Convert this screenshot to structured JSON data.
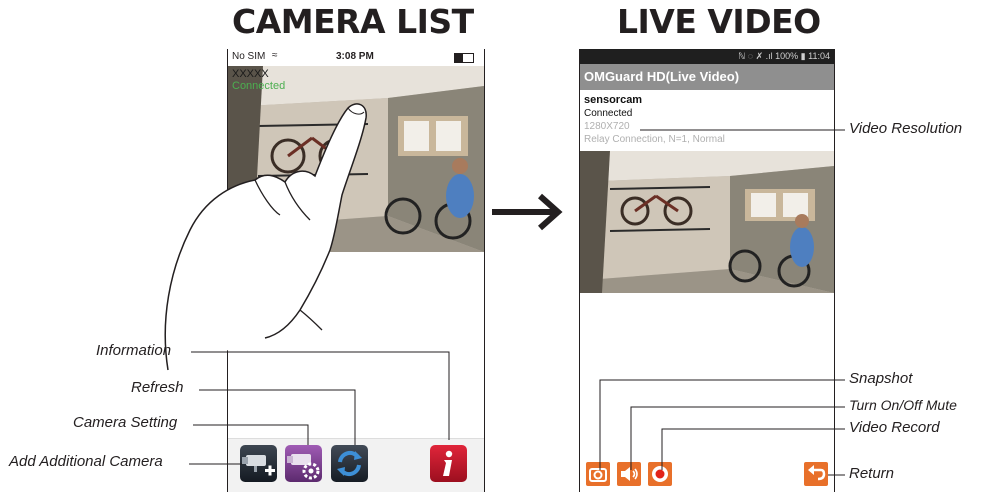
{
  "headings": {
    "left": "CAMERA LIST",
    "right": "LIVE VIDEO"
  },
  "camera_list": {
    "status_bar": {
      "carrier": "No SIM",
      "time": "3:08 PM"
    },
    "camera_name": "XXXXX",
    "camera_status": "Connected"
  },
  "live_video": {
    "status_bar": {
      "indicators": "ℕ ◌ ✗ .ıl 100% ▮ 11:04"
    },
    "title": "OMGuard HD(Live Video)",
    "device_name": "sensorcam",
    "connection_status": "Connected",
    "resolution": "1280X720",
    "relay_info": "Relay Connection, N=1, Normal"
  },
  "callouts": {
    "information": "Information",
    "refresh": "Refresh",
    "camera_setting": "Camera Setting",
    "add_camera": "Add Additional Camera",
    "video_resolution": "Video Resolution",
    "snapshot": "Snapshot",
    "turn_on_off_mute": "Turn On/Off Mute",
    "video_record": "Video Record",
    "return": "Return"
  },
  "icons": {
    "add_camera": "add-camera-icon",
    "camera_setting": "camera-setting-icon",
    "refresh": "refresh-icon",
    "information": "info-icon",
    "snapshot": "snapshot-icon",
    "mute": "speaker-icon",
    "record": "record-icon",
    "return": "return-icon"
  },
  "colors": {
    "android_title_bar": "#8f8f8f",
    "android_action_orange": "#e8702a",
    "info_button": "#c4172c",
    "camera_setting_button": "#7a3f8c",
    "connected_green": "#4caf50"
  }
}
